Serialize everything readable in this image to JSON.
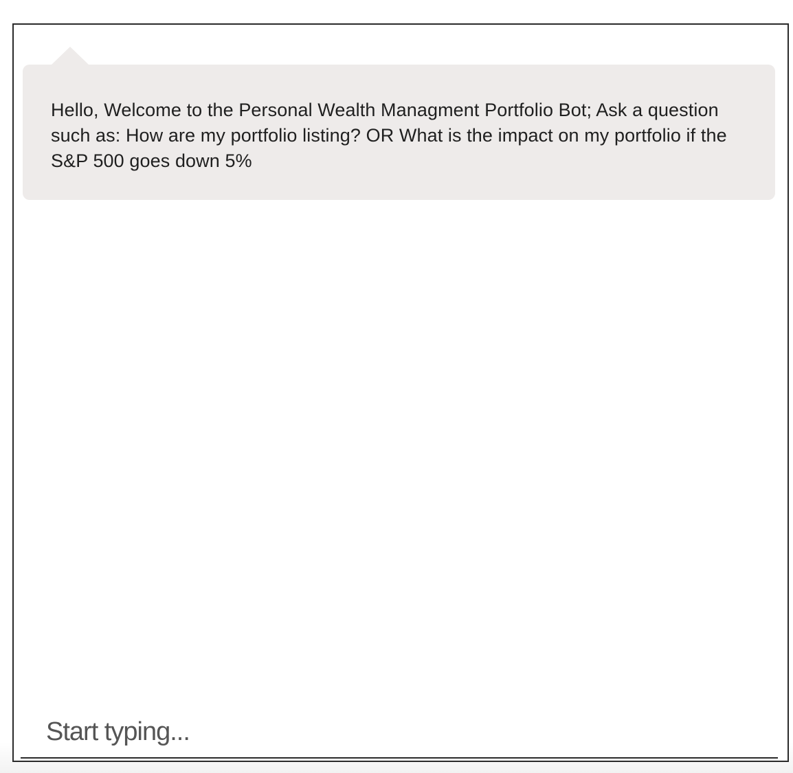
{
  "conversation": {
    "messages": [
      {
        "sender": "bot",
        "text": "Hello, Welcome to the Personal Wealth Managment Portfolio Bot; Ask a question such as: How are my portfolio listing? OR What is the impact on my portfolio if the S&P 500 goes down 5%"
      }
    ]
  },
  "input": {
    "value": "",
    "placeholder": "Start typing..."
  },
  "colors": {
    "bubble_background": "#eeebea",
    "border": "#2a2a2a",
    "text": "#1f1f1f"
  }
}
